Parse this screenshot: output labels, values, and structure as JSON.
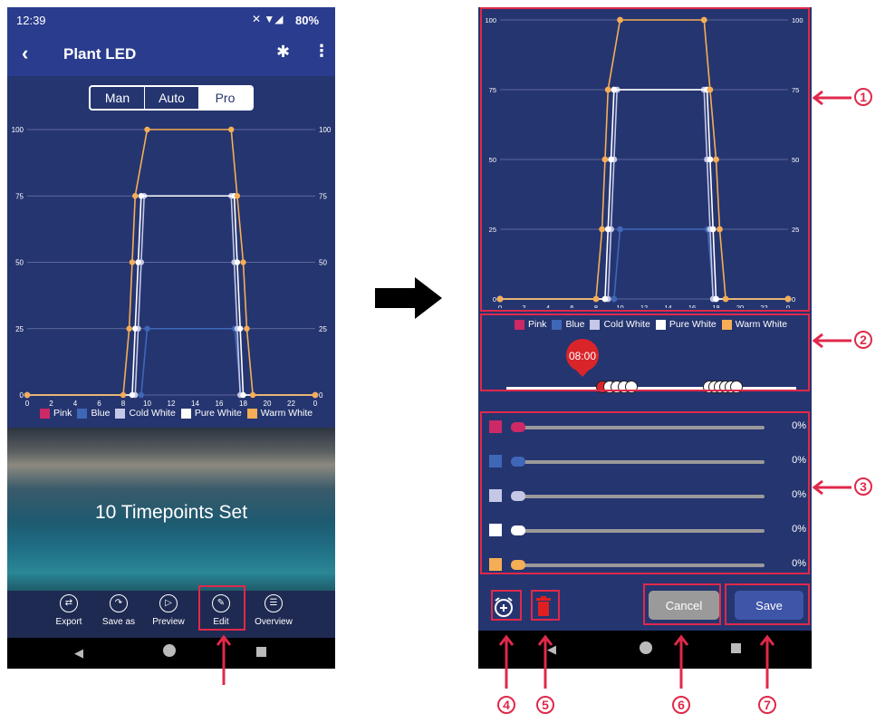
{
  "status_bar": {
    "time": "12:39",
    "battery": "80%"
  },
  "app_bar": {
    "title": "Plant LED",
    "back_icon": "back-arrow-icon",
    "bluetooth_icon": "bluetooth-icon",
    "menu_icon": "more-vert-icon"
  },
  "mode_tabs": [
    {
      "label": "Man",
      "selected": false
    },
    {
      "label": "Auto",
      "selected": false
    },
    {
      "label": "Pro",
      "selected": true
    }
  ],
  "hero": {
    "text": "10 Timepoints Set"
  },
  "toolbar": [
    {
      "label": "Export",
      "icon": "export-icon"
    },
    {
      "label": "Save as",
      "icon": "share-icon"
    },
    {
      "label": "Preview",
      "icon": "play-icon"
    },
    {
      "label": "Edit",
      "icon": "pencil-icon"
    },
    {
      "label": "Overview",
      "icon": "list-icon"
    }
  ],
  "legend": [
    {
      "name": "Pink",
      "color": "#cc2966"
    },
    {
      "name": "Blue",
      "color": "#3f67b8"
    },
    {
      "name": "Cold White",
      "color": "#c5c7e6"
    },
    {
      "name": "Pure White",
      "color": "#ffffff"
    },
    {
      "name": "Warm White",
      "color": "#f5ae55"
    }
  ],
  "chart_data": {
    "type": "line",
    "x_ticks": [
      0,
      2,
      4,
      6,
      8,
      10,
      12,
      14,
      16,
      18,
      20,
      22,
      0
    ],
    "y_ticks": [
      0,
      25,
      50,
      75,
      100
    ],
    "xlim": [
      0,
      24
    ],
    "ylim": [
      0,
      100
    ],
    "grid": true,
    "legend_position": "bottom",
    "series": [
      {
        "name": "Blue",
        "color": "#3f67b8",
        "x": [
          0,
          9.5,
          10,
          17.3,
          17.8,
          24
        ],
        "y": [
          0,
          0,
          25,
          25,
          0,
          0
        ]
      },
      {
        "name": "Cold White",
        "color": "#c5c7e6",
        "x": [
          0,
          9.0,
          9.25,
          9.5,
          9.75,
          17.0,
          17.25,
          17.5,
          17.75,
          24
        ],
        "y": [
          0,
          0,
          25,
          50,
          75,
          75,
          50,
          25,
          0,
          0
        ]
      },
      {
        "name": "Pure White",
        "color": "#ffffff",
        "x": [
          0,
          8.75,
          9.0,
          9.25,
          9.5,
          17.25,
          17.5,
          17.75,
          18.0,
          24
        ],
        "y": [
          0,
          0,
          25,
          50,
          75,
          75,
          50,
          25,
          0,
          0
        ]
      },
      {
        "name": "Warm White",
        "color": "#f5ae55",
        "x": [
          0,
          8.0,
          8.5,
          8.75,
          9.0,
          10.0,
          17.0,
          17.5,
          18.0,
          18.3,
          18.8,
          24
        ],
        "y": [
          0,
          0,
          25,
          50,
          75,
          100,
          100,
          75,
          50,
          25,
          0,
          0
        ]
      }
    ]
  },
  "timeline": {
    "marker_time": "08:00",
    "clock_icon": "clock-icon"
  },
  "sliders": [
    {
      "channel": "Pink",
      "color": "#cc2966",
      "value": "0%"
    },
    {
      "channel": "Blue",
      "color": "#3f67b8",
      "value": "0%"
    },
    {
      "channel": "Cold White",
      "color": "#c5c7e6",
      "value": "0%"
    },
    {
      "channel": "Pure White",
      "color": "#ffffff",
      "value": "0%"
    },
    {
      "channel": "Warm White",
      "color": "#f5ae55",
      "value": "0%"
    }
  ],
  "actions": {
    "cancel": "Cancel",
    "save": "Save"
  },
  "callouts": [
    "1",
    "2",
    "3",
    "4",
    "5",
    "6",
    "7"
  ]
}
